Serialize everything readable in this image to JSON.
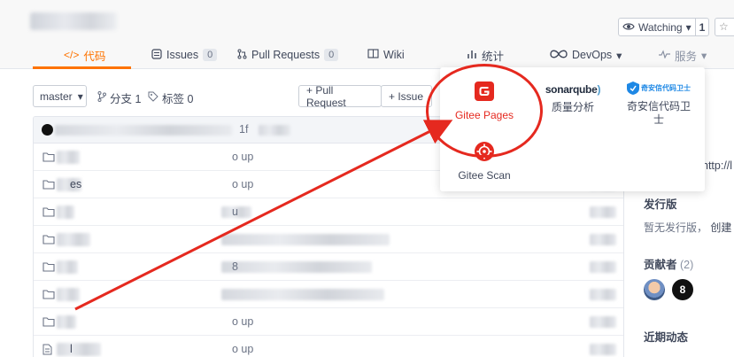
{
  "header": {
    "watch_label": "Watching",
    "watch_count": "1"
  },
  "tabs": [
    {
      "label": "代码"
    },
    {
      "label": "Issues",
      "count": "0"
    },
    {
      "label": "Pull Requests",
      "count": "0"
    },
    {
      "label": "Wiki"
    },
    {
      "label": "统计"
    },
    {
      "label": "DevOps"
    },
    {
      "label": "服务"
    }
  ],
  "toolbar": {
    "branch": "master",
    "branches_label": "分支 1",
    "tags_label": "标签 0",
    "pull_request_label": "+ Pull Request",
    "issue_label": "+ Issue"
  },
  "commit_bar": {
    "hash_fragment": "1f"
  },
  "files": [
    {
      "name": "",
      "msg": "o up"
    },
    {
      "name": "es",
      "msg": "o up"
    },
    {
      "name": "",
      "msg": "u"
    },
    {
      "name": "",
      "msg": ""
    },
    {
      "name": "",
      "msg": "8"
    },
    {
      "name": "",
      "msg": ""
    },
    {
      "name": "",
      "msg": "o up"
    },
    {
      "name": "l",
      "msg": "o up"
    }
  ],
  "sidebar": {
    "link_fragment": "http://l",
    "release_heading": "发行版",
    "release_text": "暂无发行版，",
    "create_label": "创建",
    "contributors_heading": "贡献者",
    "contributors_count": "(2)",
    "contributor_badge": "8",
    "activity_heading": "近期动态"
  },
  "services_menu": {
    "items": [
      {
        "label": "Gitee Pages",
        "icon": "gitee-pages-icon",
        "color": "#e5291f"
      },
      {
        "label": "质量分析",
        "logo_text": "sonarqube",
        "icon": "sonarqube-logo"
      },
      {
        "label": "奇安信代码卫士",
        "logo_text": "奇安信代码卫士",
        "icon": "qianxin-logo"
      },
      {
        "label": "Gitee Scan",
        "icon": "gitee-scan-icon",
        "color": "#e5291f"
      }
    ]
  },
  "colors": {
    "accent": "#fe7300",
    "annotation": "#e5291f"
  }
}
